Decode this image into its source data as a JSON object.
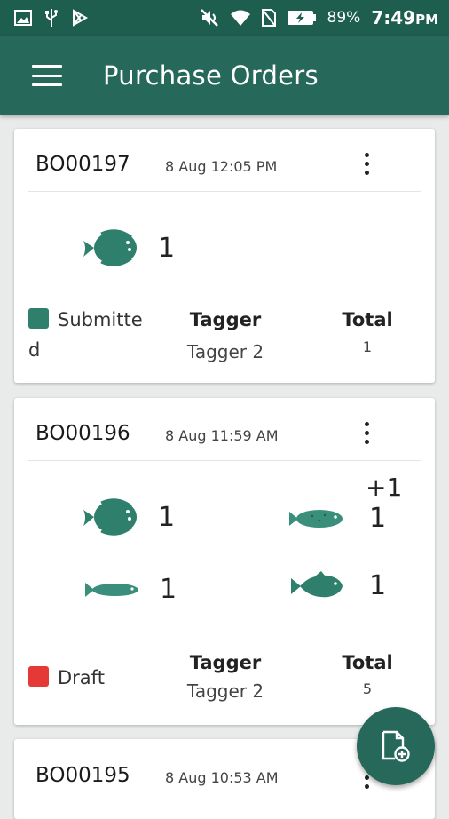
{
  "status_bar": {
    "battery_percent": "89%",
    "time": "7:49",
    "time_suffix": "PM"
  },
  "app_bar": {
    "title": "Purchase Orders",
    "menu_icon": "hamburger-menu-icon"
  },
  "labels": {
    "tagger_header": "Tagger",
    "total_header": "Total"
  },
  "orders": [
    {
      "id": "BO00197",
      "date": "8 Aug 12:05 PM",
      "items": [
        {
          "icon": "flatfish-icon",
          "count": "1"
        }
      ],
      "status": {
        "label": "Submitted",
        "display": "Submitte\nd",
        "color": "#2f7f6d"
      },
      "tagger": "Tagger 2",
      "total": "1"
    },
    {
      "id": "BO00196",
      "date": "8 Aug 11:59 AM",
      "extra": "+1",
      "items": [
        {
          "icon": "flatfish-icon",
          "count": "1"
        },
        {
          "icon": "trout-icon",
          "count": "1"
        },
        {
          "icon": "sardine-icon",
          "count": "1"
        },
        {
          "icon": "salmon-icon",
          "count": "1"
        }
      ],
      "status": {
        "label": "Draft",
        "display": "Draft",
        "color": "#e53935"
      },
      "tagger": "Tagger 2",
      "total": "5"
    },
    {
      "id": "BO00195",
      "date": "8 Aug 10:53 AM"
    }
  ],
  "fab": {
    "icon": "new-document-icon"
  }
}
